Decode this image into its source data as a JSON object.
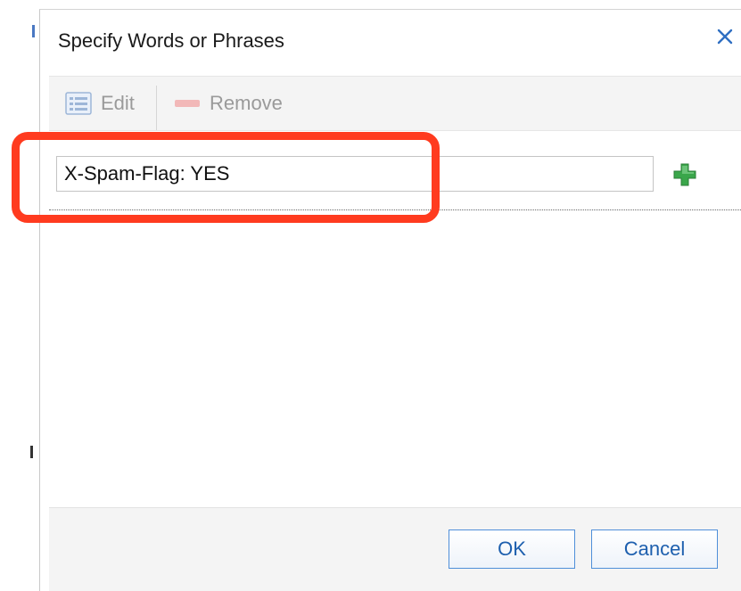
{
  "dialog": {
    "title": "Specify Words or Phrases",
    "close_icon": "close-icon"
  },
  "toolbar": {
    "edit_label": "Edit",
    "edit_icon": "list-edit-icon",
    "remove_label": "Remove",
    "remove_icon": "minus-icon"
  },
  "phrases": {
    "input_value": "X-Spam-Flag: YES",
    "add_icon": "plus-icon"
  },
  "footer": {
    "ok_label": "OK",
    "cancel_label": "Cancel"
  },
  "colors": {
    "highlight": "#ff3b1f",
    "add_icon": "#3aa64a",
    "button_text": "#1d5fae",
    "close_icon": "#2f6fc2"
  }
}
